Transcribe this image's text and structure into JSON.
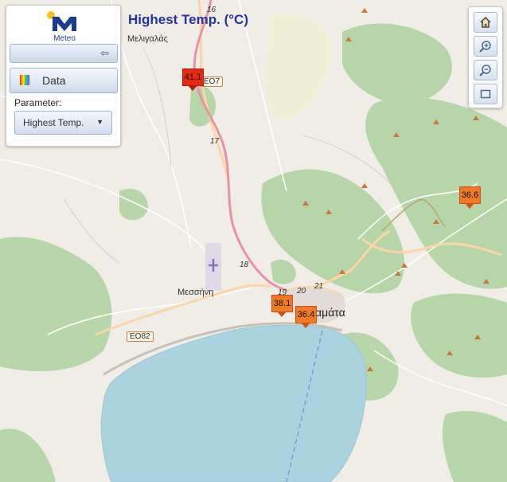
{
  "title": "Highest Temp. (°C)",
  "logo": {
    "text": "Meteo"
  },
  "panel": {
    "data_button": "Data",
    "parameter_label": "Parameter:",
    "parameter_value": "Highest Temp."
  },
  "toolbar": {
    "icons": [
      "home-icon",
      "zoom-in-icon",
      "zoom-out-icon",
      "zoom-extent-icon"
    ]
  },
  "markers": [
    {
      "value": "41.1",
      "color": "#e62a12"
    },
    {
      "value": "36.6",
      "color": "#f07a22"
    },
    {
      "value": "38.1",
      "color": "#f07a22"
    },
    {
      "value": "36.4",
      "color": "#f07a22"
    }
  ],
  "places": {
    "meligalas": "Μελιγαλάς",
    "messini": "Μεσσήνη",
    "kalamata": "Καλαμάτα"
  },
  "roads": {
    "eo82": "EO82",
    "eo7": "EO7",
    "r16": "16",
    "r17": "17",
    "r18": "18",
    "r19": "19",
    "r20": "20",
    "r21": "21"
  },
  "colors": {
    "sea": "#aad3df",
    "forest": "#add19e",
    "land": "#f0ede6",
    "motorway": "#e892a2",
    "primary": "#fcd6a4",
    "title": "#2233aa"
  }
}
